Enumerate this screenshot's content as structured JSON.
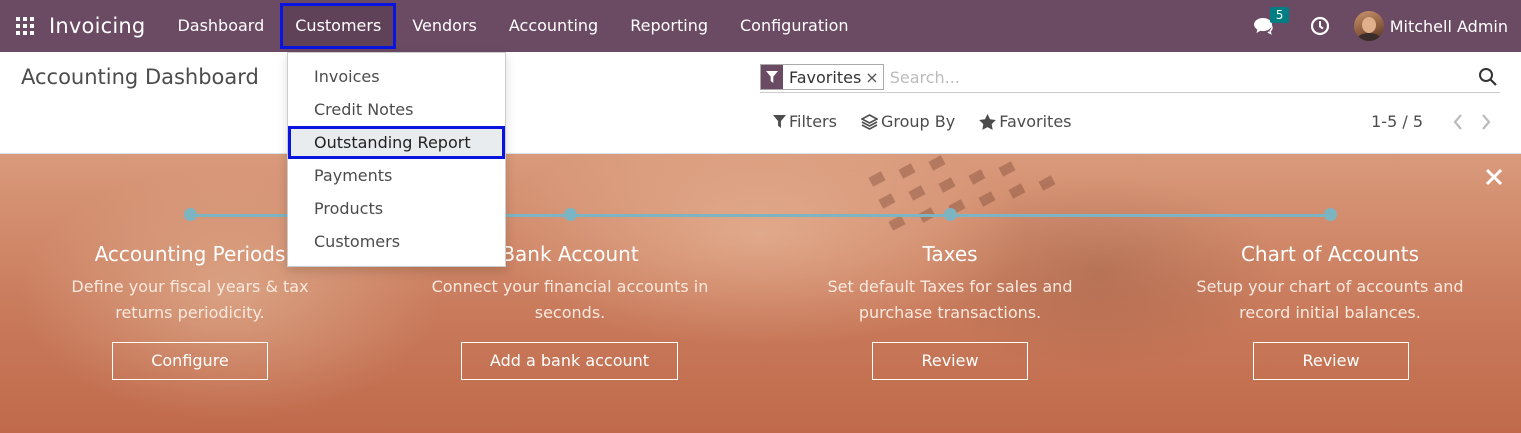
{
  "navbar": {
    "app_name": "Invoicing",
    "menu": [
      {
        "label": "Dashboard"
      },
      {
        "label": "Customers"
      },
      {
        "label": "Vendors"
      },
      {
        "label": "Accounting"
      },
      {
        "label": "Reporting"
      },
      {
        "label": "Configuration"
      }
    ],
    "message_count": "5",
    "user_name": "Mitchell Admin",
    "color": "#6b4a63"
  },
  "customers_menu": {
    "items": [
      {
        "label": "Invoices"
      },
      {
        "label": "Credit Notes"
      },
      {
        "label": "Outstanding Report"
      },
      {
        "label": "Payments"
      },
      {
        "label": "Products"
      },
      {
        "label": "Customers"
      }
    ]
  },
  "control_panel": {
    "title": "Accounting Dashboard",
    "facet_label": "Favorites",
    "facet_close": "×",
    "search_placeholder": "Search...",
    "filters_label": "Filters",
    "group_by_label": "Group By",
    "favorites_label": "Favorites",
    "pager": "1-5 / 5"
  },
  "banner": {
    "close": "×",
    "steps": [
      {
        "title": "Accounting Periods",
        "desc_line1": "Define your fiscal years & tax",
        "desc_line2": "returns periodicity.",
        "button": "Configure"
      },
      {
        "title": "Bank Account",
        "desc_line1": "Connect your financial accounts in",
        "desc_line2": "seconds.",
        "button": "Add a bank account"
      },
      {
        "title": "Taxes",
        "desc_line1": "Set default Taxes for sales and",
        "desc_line2": "purchase transactions.",
        "button": "Review"
      },
      {
        "title": "Chart of Accounts",
        "desc_line1": "Setup your chart of accounts and",
        "desc_line2": "record initial balances.",
        "button": "Review"
      }
    ]
  },
  "icons": {
    "apps": "apps-grid-icon",
    "chat": "chat-icon",
    "activity": "clock-icon",
    "search": "search-icon",
    "filter": "filter-icon",
    "group_by": "layers-icon",
    "favorites": "star-icon"
  }
}
